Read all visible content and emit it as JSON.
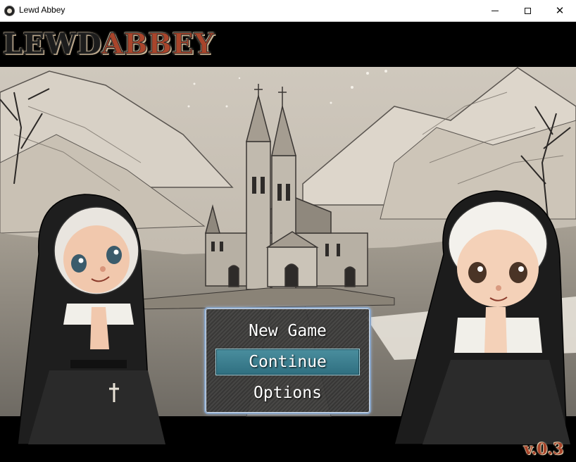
{
  "window": {
    "title": "Lewd Abbey",
    "icon": "app-icon",
    "controls": [
      "minimize-icon",
      "maximize-icon",
      "close-icon"
    ],
    "close_glyph": "✕"
  },
  "game": {
    "logo": {
      "word1": "LEWD",
      "word2": "ABBEY"
    },
    "version": "v.0.3",
    "menu": {
      "items": [
        {
          "label": "New Game",
          "selected": false
        },
        {
          "label": "Continue",
          "selected": true
        },
        {
          "label": "Options",
          "selected": false
        }
      ]
    },
    "colors": {
      "logo_dark": "#1c1c1c",
      "logo_accent": "#a9452b",
      "menu_highlight": "#3f8797",
      "menu_border": "#8aa6c8"
    }
  }
}
